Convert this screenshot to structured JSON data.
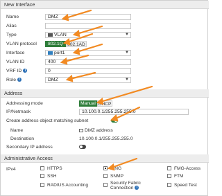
{
  "header": {
    "title": "New Interface"
  },
  "form": {
    "name_label": "Name",
    "name_value": "DMZ",
    "alias_label": "Alias",
    "alias_value": "",
    "type_label": "Type",
    "type_value": "VLAN",
    "vlan_protocol_label": "VLAN protocol",
    "vlan_protocol_options": [
      "802.1Q",
      "802.1AD"
    ],
    "vlan_protocol_selected": "802.1Q",
    "interface_label": "Interface",
    "interface_value": "port1",
    "vlan_id_label": "VLAN ID",
    "vlan_id_value": "400",
    "vrf_id_label": "VRF ID",
    "vrf_id_value": "0",
    "role_label": "Role",
    "role_value": "DMZ"
  },
  "address": {
    "section_title": "Address",
    "addressing_mode_label": "Addressing mode",
    "addressing_mode_options": [
      "Manual",
      "DHCP"
    ],
    "addressing_mode_selected": "Manual",
    "ip_netmask_label": "IP/Netmask",
    "ip_netmask_value": "10.100.0.1/255.255.255.0",
    "create_object_label": "Create address object matching subnet",
    "create_object_enabled": true,
    "object_name_label": "Name",
    "object_name_value": "DMZ address",
    "destination_label": "Destination",
    "destination_value": "10.100.0.1/255.255.255.0",
    "secondary_ip_label": "Secondary IP address",
    "secondary_ip_enabled": false
  },
  "admin_access": {
    "section_title": "Administrative Access",
    "ipv4_label": "IPv4",
    "options": [
      {
        "label": "HTTPS",
        "checked": false
      },
      {
        "label": "PING",
        "checked": true
      },
      {
        "label": "FMG-Access",
        "checked": false
      },
      {
        "label": "SSH",
        "checked": false
      },
      {
        "label": "SNMP",
        "checked": false
      },
      {
        "label": "FTM",
        "checked": false
      },
      {
        "label": "RADIUS Accounting",
        "checked": false
      },
      {
        "label": "Security Fabric Connection",
        "checked": false
      },
      {
        "label": "Speed Test",
        "checked": false
      }
    ]
  },
  "colors": {
    "accent_green": "#2e7d3a",
    "annotation_orange": "#f28a22",
    "info_blue": "#2b6fb6"
  },
  "icons": {
    "info": "info-icon",
    "vlan": "vlan-icon",
    "port": "port-icon",
    "address": "address-object-icon",
    "dropdown": "chevron-down-icon"
  }
}
